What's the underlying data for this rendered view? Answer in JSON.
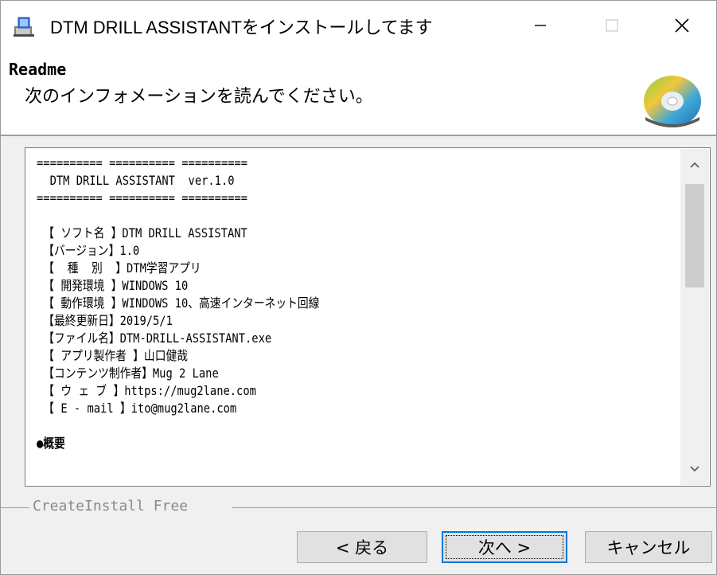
{
  "window": {
    "title": "DTM DRILL ASSISTANTをインストールしてます",
    "app_icon": "installer-icon",
    "controls": [
      "minimize-icon",
      "maximize-icon",
      "close-icon"
    ]
  },
  "header": {
    "title": "Readme",
    "subtitle": "次のインフォメーションを読んでください。",
    "icon": "cd-icon"
  },
  "readme": {
    "lines": [
      "========== ========== ==========",
      "  DTM DRILL ASSISTANT  ver.1.0",
      "========== ========== ==========",
      "",
      " 【 ソフト名 】DTM DRILL ASSISTANT",
      " 【バージョン】1.0",
      " 【  種  別  】DTM学習アプリ",
      " 【 開発環境 】WINDOWS 10",
      " 【 動作環境 】WINDOWS 10、高速インターネット回線",
      " 【最終更新日】2019/5/1",
      " 【ファイル名】DTM-DRILL-ASSISTANT.exe",
      " 【 アプリ製作者 】山口健哉",
      " 【コンテンツ制作者】Mug 2 Lane",
      " 【 ウ ェ ブ 】https://mug2lane.com",
      " 【 E - mail 】ito@mug2lane.com",
      "",
      "●概要"
    ]
  },
  "branding": "CreateInstall Free",
  "buttons": {
    "back": "< 戻る",
    "next": "次へ >",
    "cancel": "キャンセル"
  },
  "colors": {
    "focus_border": "#0078d7",
    "scroll_thumb": "#cdcdcd"
  }
}
